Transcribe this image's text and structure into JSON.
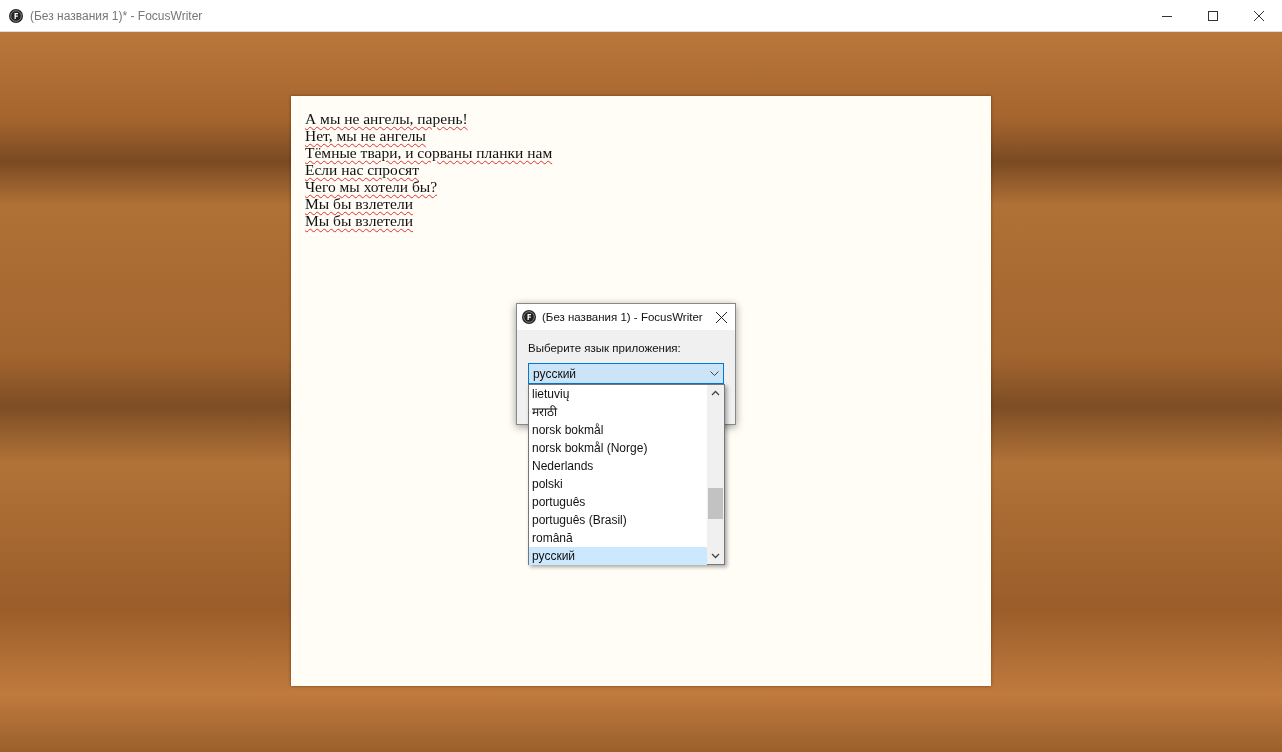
{
  "window": {
    "title": "(Без названия 1)* - FocusWriter"
  },
  "document": {
    "lines": [
      {
        "text": "А мы не ангелы, парень!",
        "spell_marked": true
      },
      {
        "text": "Нет, мы не ангелы",
        "spell_marked": true
      },
      {
        "text": "Тёмные твари, и сорваны планки нам",
        "spell_marked": true
      },
      {
        "text": "Если нас спросят",
        "spell_marked": true
      },
      {
        "text": "Чего мы хотели бы?",
        "spell_marked": true
      },
      {
        "text": "Мы бы взлетели",
        "spell_marked": true
      },
      {
        "text": "Мы бы взлетели",
        "spell_marked": true
      }
    ]
  },
  "dialog": {
    "title": "(Без названия 1) - FocusWriter",
    "label": "Выберите язык приложения:",
    "combo_value": "русский",
    "options": [
      {
        "label": "lietuvių",
        "selected": false
      },
      {
        "label": "मराठी",
        "selected": false
      },
      {
        "label": "norsk bokmål",
        "selected": false
      },
      {
        "label": "norsk bokmål (Norge)",
        "selected": false
      },
      {
        "label": "Nederlands",
        "selected": false
      },
      {
        "label": "polski",
        "selected": false
      },
      {
        "label": "português",
        "selected": false
      },
      {
        "label": "português (Brasil)",
        "selected": false
      },
      {
        "label": "română",
        "selected": false
      },
      {
        "label": "русский",
        "selected": true
      }
    ]
  }
}
